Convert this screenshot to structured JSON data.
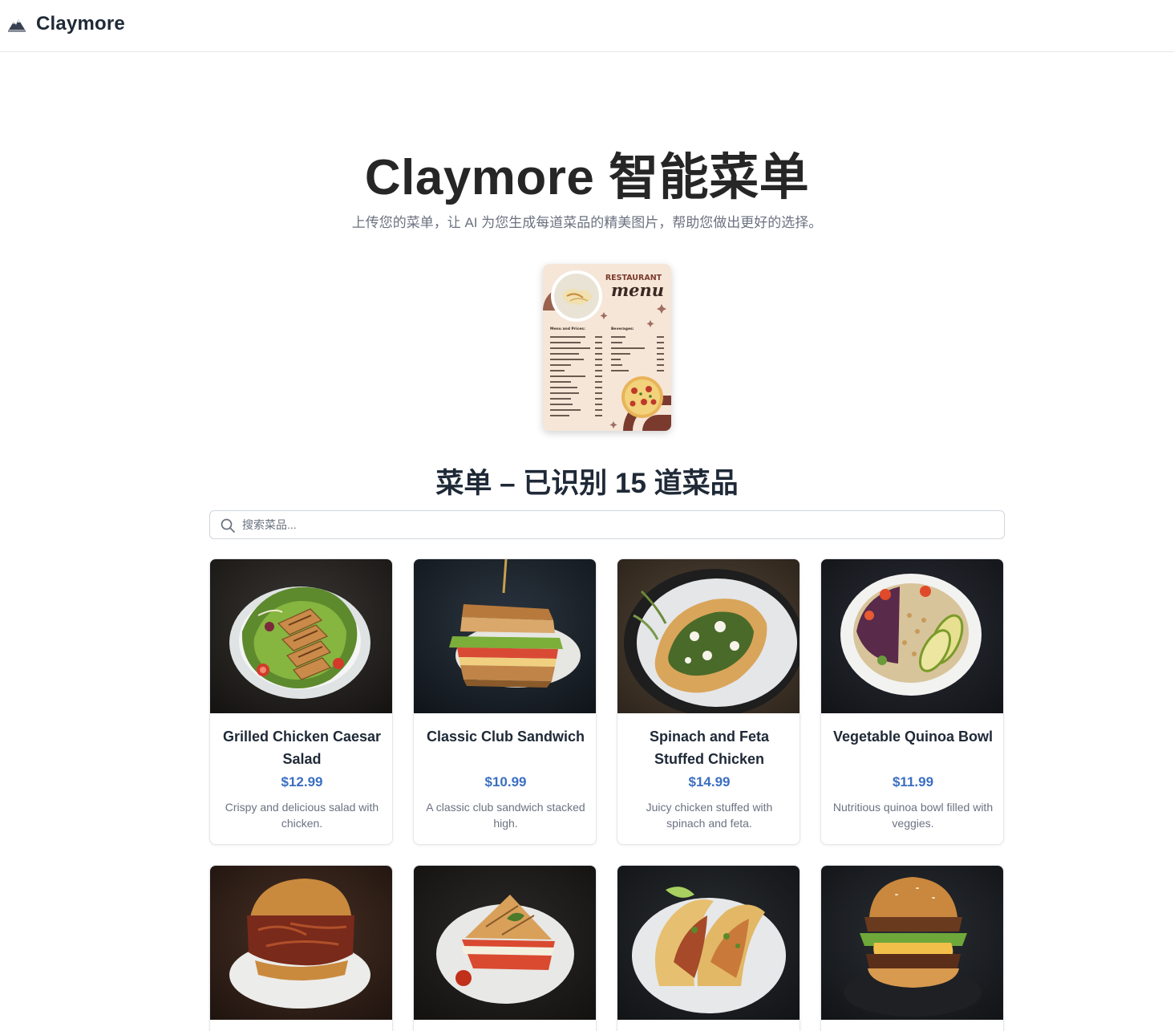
{
  "header": {
    "logo_icon": "claymore-mountain-logo-icon",
    "brand": "Claymore"
  },
  "hero": {
    "title": "Claymore 智能菜单",
    "subtitle": "上传您的菜单，让 AI 为您生成每道菜品的精美图片，帮助您做出更好的选择。"
  },
  "menu_thumbnail": {
    "heading_top": "RESTAURANT",
    "heading_script": "menu",
    "left_title": "Menu and Prices:",
    "right_title": "Beverages:"
  },
  "menu_section": {
    "title": "菜单 – 已识别 15 道菜品",
    "search_placeholder": "搜索菜品...",
    "search_icon": "search-icon"
  },
  "colors": {
    "price": "#3b6fc1",
    "thumbnail_bg": "#f6e6d8",
    "thumbnail_accent": "#7a3b2e"
  },
  "dishes": [
    {
      "name": "Grilled Chicken Caesar Salad",
      "price": "$12.99",
      "description": "Crispy and delicious salad with chicken.",
      "image": "grilled-chicken-salad-photo"
    },
    {
      "name": "Classic Club Sandwich",
      "price": "$10.99",
      "description": "A classic club sandwich stacked high.",
      "image": "club-sandwich-photo"
    },
    {
      "name": "Spinach and Feta Stuffed Chicken",
      "price": "$14.99",
      "description": "Juicy chicken stuffed with spinach and feta.",
      "image": "stuffed-chicken-photo"
    },
    {
      "name": "Vegetable Quinoa Bowl",
      "price": "$11.99",
      "description": "Nutritious quinoa bowl filled with veggies.",
      "image": "quinoa-bowl-photo"
    },
    {
      "image": "pulled-pork-sandwich-photo"
    },
    {
      "image": "grilled-panini-photo"
    },
    {
      "image": "fish-tacos-photo"
    },
    {
      "image": "cheeseburger-photo"
    }
  ]
}
